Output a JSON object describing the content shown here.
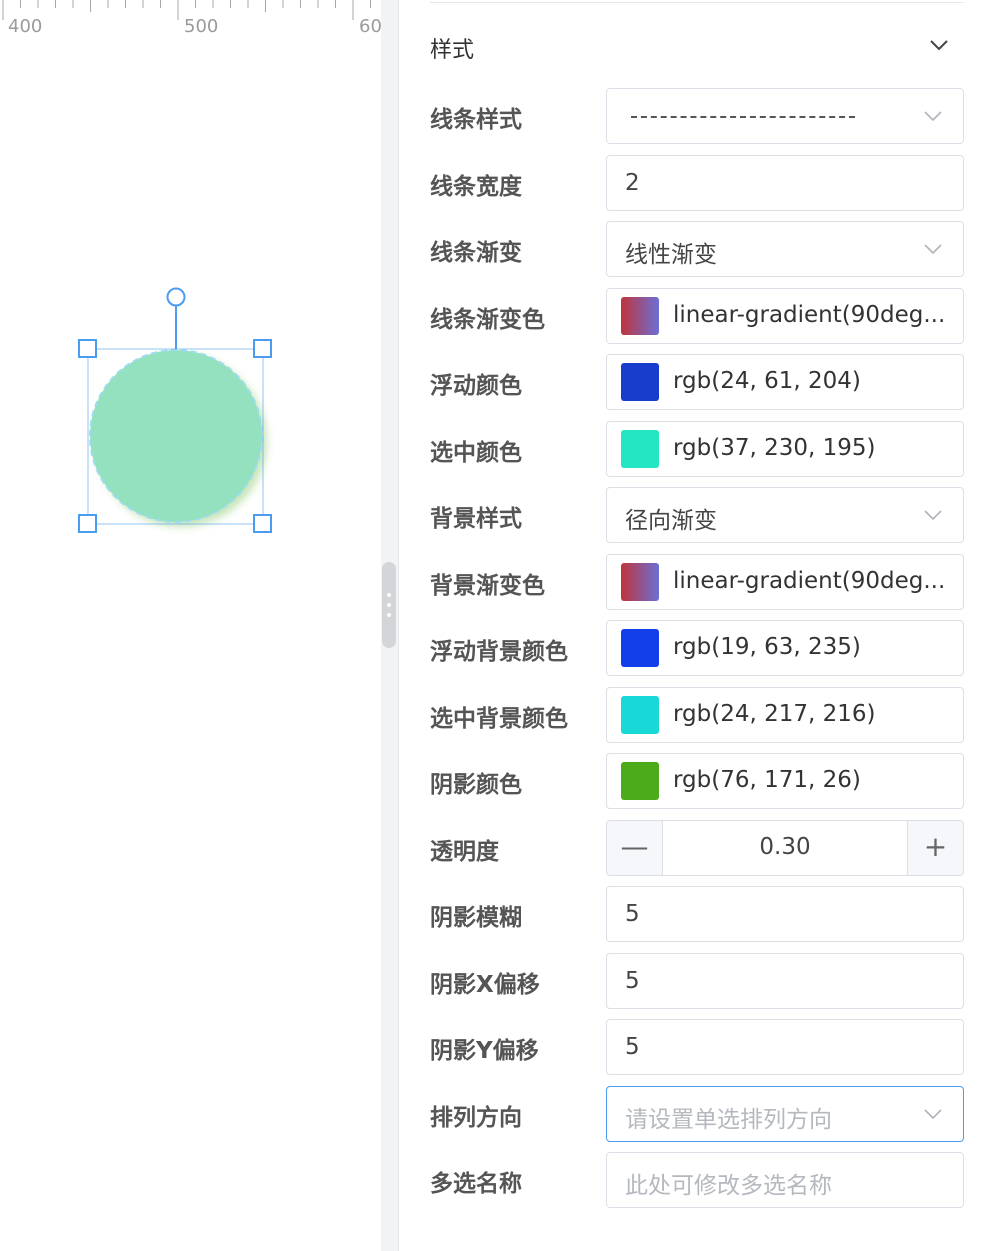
{
  "ruler": {
    "labels": [
      "400",
      "500",
      "60"
    ]
  },
  "canvas_shape": {
    "fill": "#93e1bf",
    "border": "#9fdcf0",
    "shadow": "#4cab1a",
    "selection_color": "#4a9cf0"
  },
  "panel": {
    "section_title": "样式",
    "rows": [
      {
        "label": "线条样式",
        "type": "select-dashed"
      },
      {
        "label": "线条宽度",
        "type": "input",
        "value": "2"
      },
      {
        "label": "线条渐变",
        "type": "select",
        "value": "线性渐变"
      },
      {
        "label": "线条渐变色",
        "type": "color",
        "value": "linear-gradient(90deg...",
        "gradient": [
          "#c0343a",
          "#6b6fd6"
        ]
      },
      {
        "label": "浮动颜色",
        "type": "color",
        "value": "rgb(24, 61, 204)",
        "color": "#183dcc"
      },
      {
        "label": "选中颜色",
        "type": "color",
        "value": "rgb(37, 230, 195)",
        "color": "#25e6c3"
      },
      {
        "label": "背景样式",
        "type": "select",
        "value": "径向渐变"
      },
      {
        "label": "背景渐变色",
        "type": "color",
        "value": "linear-gradient(90deg...",
        "gradient": [
          "#c0343a",
          "#6b6fd6"
        ]
      },
      {
        "label": "浮动背景颜色",
        "type": "color",
        "value": "rgb(19, 63, 235)",
        "color": "#133feb"
      },
      {
        "label": "选中背景颜色",
        "type": "color",
        "value": "rgb(24, 217, 216)",
        "color": "#18d9d8"
      },
      {
        "label": "阴影颜色",
        "type": "color",
        "value": "rgb(76, 171, 26)",
        "color": "#4cab1a"
      },
      {
        "label": "透明度",
        "type": "stepper",
        "value": "0.30",
        "minus": "—",
        "plus": "+"
      },
      {
        "label": "阴影模糊",
        "type": "input",
        "value": "5"
      },
      {
        "label": "阴影X偏移",
        "type": "input",
        "value": "5"
      },
      {
        "label": "阴影Y偏移",
        "type": "input",
        "value": "5"
      },
      {
        "label": "排列方向",
        "type": "select",
        "placeholder": "请设置单选排列方向",
        "focused": true
      },
      {
        "label": "多选名称",
        "type": "input",
        "placeholder": "此处可修改多选名称"
      }
    ]
  }
}
